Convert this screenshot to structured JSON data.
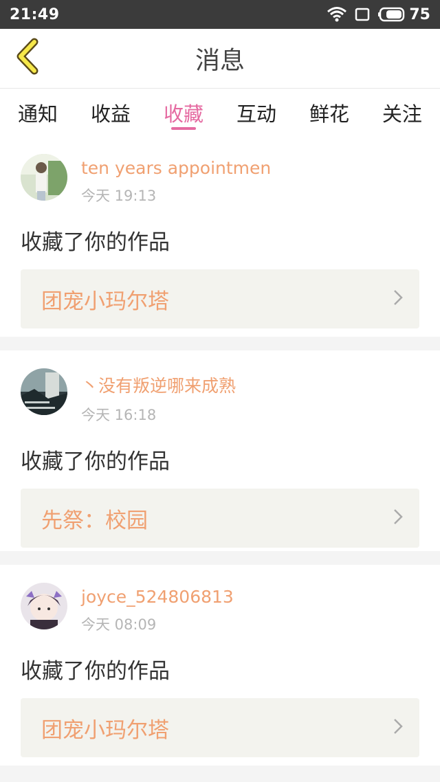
{
  "status_bar": {
    "time": "21:49",
    "battery": "75"
  },
  "header": {
    "title": "消息"
  },
  "tabs": [
    {
      "label": "通知"
    },
    {
      "label": "收益"
    },
    {
      "label": "收藏",
      "active": true
    },
    {
      "label": "互动"
    },
    {
      "label": "鲜花"
    },
    {
      "label": "关注"
    }
  ],
  "feed": [
    {
      "username": "ten years appointmen",
      "time": "今天 19:13",
      "action": "收藏了你的作品",
      "work_title": "团宠小玛尔塔"
    },
    {
      "username": "丶没有叛逆哪来成熟",
      "time": "今天 16:18",
      "action": "收藏了你的作品",
      "work_title": "先祭：校园"
    },
    {
      "username": "joyce_524806813",
      "time": "今天 08:09",
      "action": "收藏了你的作品",
      "work_title": "团宠小玛尔塔"
    }
  ],
  "colors": {
    "accent_pink": "#e56aa1",
    "username_orange": "#f0a071",
    "status_bar": "#3b3b3b"
  },
  "icons": [
    "wifi-icon",
    "screen-icon",
    "battery-icon",
    "back-arrow-icon",
    "chevron-right-icon"
  ]
}
